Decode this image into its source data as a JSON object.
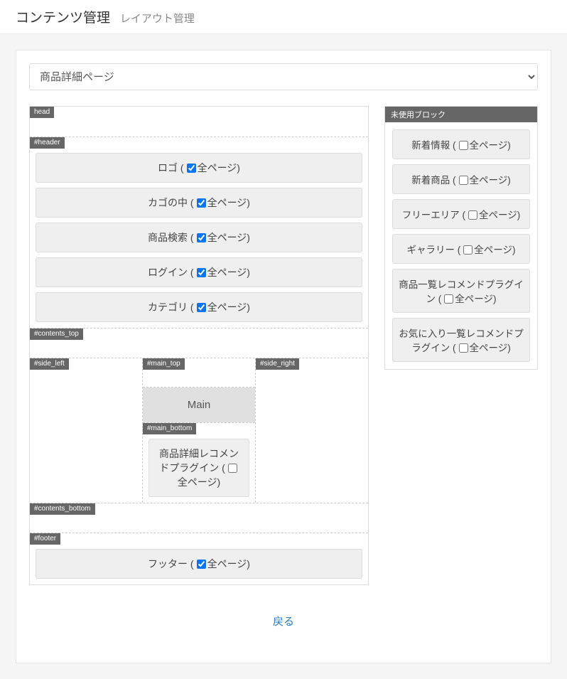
{
  "breadcrumb": {
    "title": "コンテンツ管理",
    "subtitle": "レイアウト管理"
  },
  "page_select": {
    "value": "商品詳細ページ"
  },
  "all_pages_label": "全ページ",
  "regions": {
    "head": {
      "tag": "head"
    },
    "header": {
      "tag": "#header",
      "blocks": [
        {
          "label": "ロゴ",
          "checked": true
        },
        {
          "label": "カゴの中",
          "checked": true
        },
        {
          "label": "商品検索",
          "checked": true
        },
        {
          "label": "ログイン",
          "checked": true
        },
        {
          "label": "カテゴリ",
          "checked": true
        }
      ]
    },
    "contents_top": {
      "tag": "#contents_top"
    },
    "side_left": {
      "tag": "#side_left"
    },
    "main_top": {
      "tag": "#main_top"
    },
    "main": {
      "label": "Main"
    },
    "main_bottom": {
      "tag": "#main_bottom",
      "blocks": [
        {
          "label": "商品詳細レコメンドプラグイン",
          "checked": false
        }
      ]
    },
    "side_right": {
      "tag": "#side_right"
    },
    "contents_bottom": {
      "tag": "#contents_bottom"
    },
    "footer": {
      "tag": "#footer",
      "blocks": [
        {
          "label": "フッター",
          "checked": true
        }
      ]
    }
  },
  "unused": {
    "title": "未使用ブロック",
    "blocks": [
      {
        "label": "新着情報",
        "checked": false
      },
      {
        "label": "新着商品",
        "checked": false
      },
      {
        "label": "フリーエリア",
        "checked": false
      },
      {
        "label": "ギャラリー",
        "checked": false
      },
      {
        "label": "商品一覧レコメンドプラグイン",
        "checked": false
      },
      {
        "label": "お気に入り一覧レコメンドプラグイン",
        "checked": false
      }
    ]
  },
  "back_label": "戻る"
}
